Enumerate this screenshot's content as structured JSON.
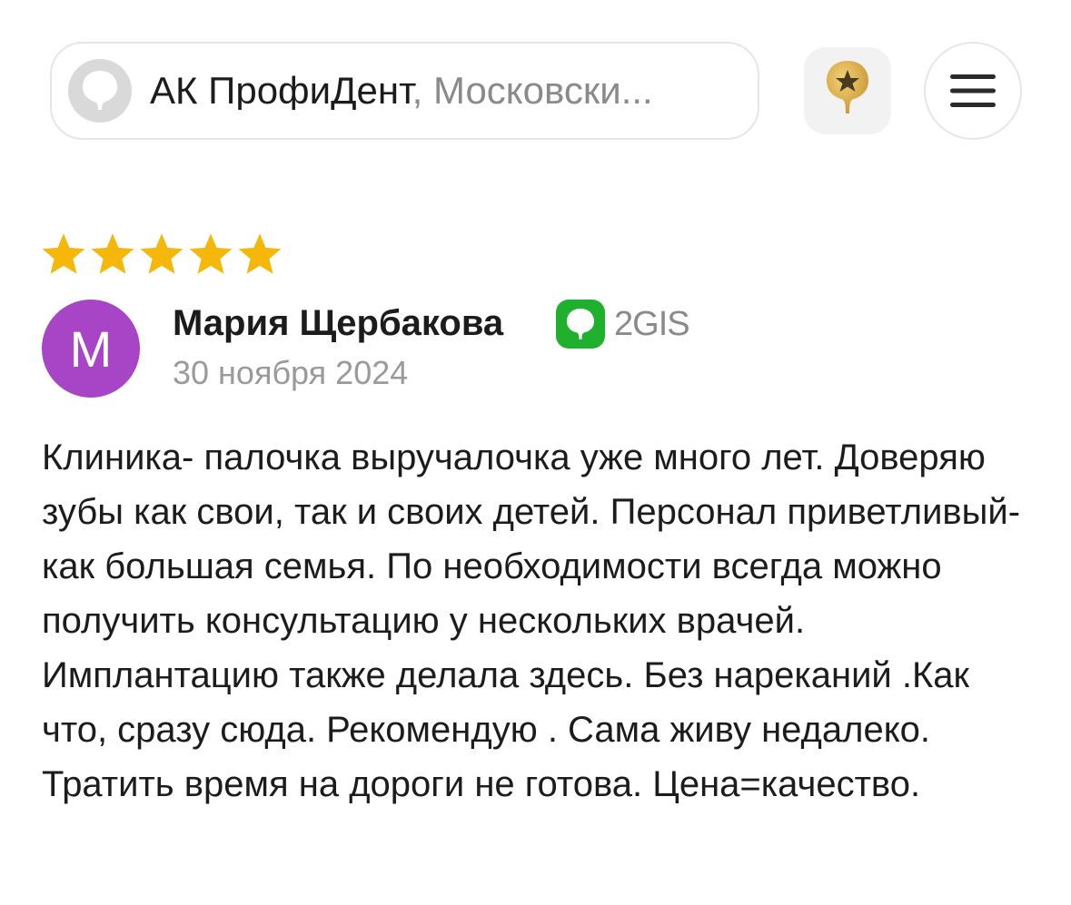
{
  "header": {
    "title": "АК ПрофиДент",
    "subtitle": ", Московски...",
    "pin_icon": "2gis-pin-icon",
    "favorite_icon": "star-pin-icon",
    "menu_icon": "hamburger-menu-icon"
  },
  "review": {
    "rating": 5,
    "rating_max": 5,
    "author_initial": "М",
    "author_name": "Мария Щербакова",
    "source_label": "2GIS",
    "date": "30 ноября 2024",
    "text": "Клиника- палочка выручалочка уже много лет. Доверяю зубы как свои, так и своих детей. Персонал приветливый-как большая семья. По необходимости всегда можно получить консультацию у нескольких врачей. Имплантацию также делала здесь. Без нареканий .Как что, сразу сюда. Рекомендую . Сама живу недалеко. Тратить время на дороги не готова. Цена=качество."
  },
  "colors": {
    "star": "#f5b70a",
    "avatar": "#a845c6",
    "source_badge": "#1fb12e"
  }
}
